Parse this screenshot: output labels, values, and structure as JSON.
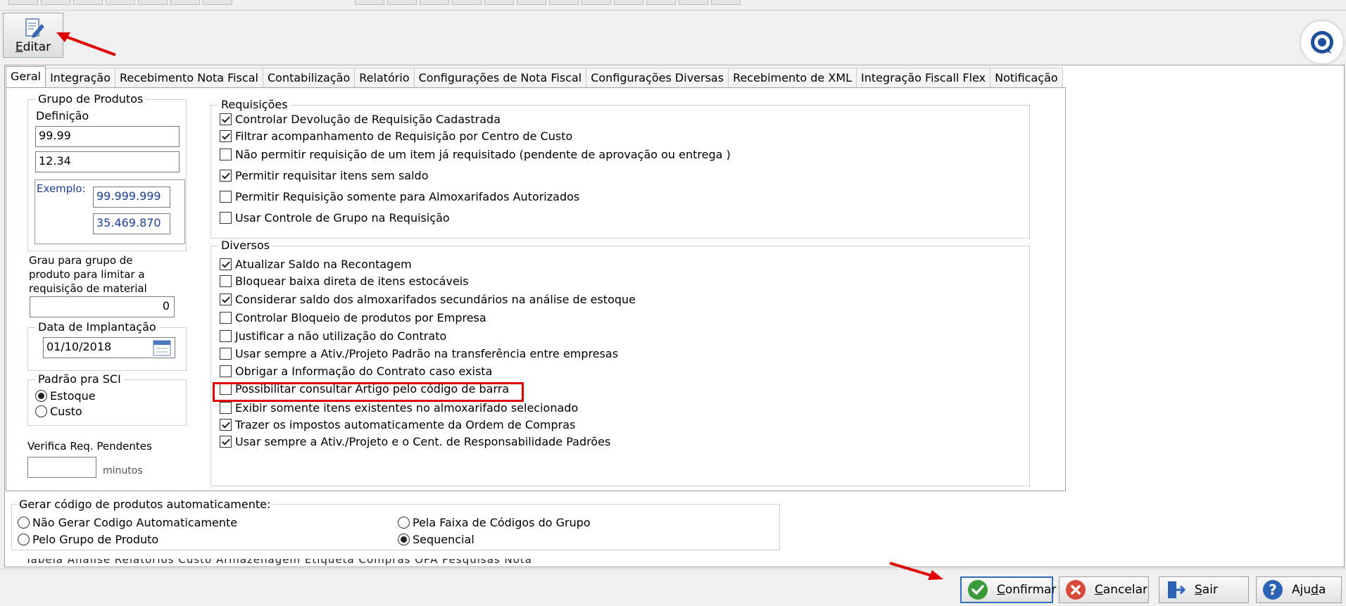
{
  "toolbar": {
    "edit_label_u": "E",
    "edit_label_rest": "ditar"
  },
  "tabs": [
    {
      "label": "Geral",
      "active": true
    },
    {
      "label": "Integração",
      "active": false
    },
    {
      "label": "Recebimento Nota Fiscal",
      "active": false
    },
    {
      "label": "Contabilização",
      "active": false
    },
    {
      "label": "Relatório",
      "active": false
    },
    {
      "label": "Configurações de Nota Fiscal",
      "active": false
    },
    {
      "label": "Configurações Diversas",
      "active": false
    },
    {
      "label": "Recebimento de XML",
      "active": false
    },
    {
      "label": "Integração Fiscall Flex",
      "active": false
    },
    {
      "label": "Notificação",
      "active": false
    }
  ],
  "grupo_produtos": {
    "legend": "Grupo de Produtos",
    "definicao_label": "Definição",
    "definicao_1": "99.99",
    "definicao_2": "12.34",
    "exemplo_label": "Exemplo:",
    "exemplo_1": "99.999.999",
    "exemplo_2": "35.469.870"
  },
  "grau": {
    "line1": "Grau para grupo de",
    "line2": "produto para limitar a",
    "line3": "requisição de material",
    "value": "0"
  },
  "data_implantacao": {
    "legend": "Data de Implantação",
    "value": "01/10/2018"
  },
  "padrao_sci": {
    "legend": "Padrão pra SCI",
    "options": [
      {
        "label": "Estoque",
        "selected": true
      },
      {
        "label": "Custo",
        "selected": false
      }
    ]
  },
  "verifica": {
    "label": "Verifica Req. Pendentes",
    "value": "",
    "unit": "minutos"
  },
  "requisicoes": {
    "legend": "Requisições",
    "items": [
      {
        "label": "Controlar Devolução de Requisição Cadastrada",
        "checked": true
      },
      {
        "label": "Filtrar acompanhamento de Requisição por Centro de Custo",
        "checked": true
      },
      {
        "label": "Não permitir requisição de um item já requisitado (pendente de aprovação ou entrega )",
        "checked": false
      },
      {
        "label": "Permitir requisitar itens sem saldo",
        "checked": true
      },
      {
        "label": "Permitir Requisição somente para Almoxarifados Autorizados",
        "checked": false
      },
      {
        "label": "Usar Controle de Grupo na Requisição",
        "checked": false
      }
    ]
  },
  "diversos": {
    "legend": "Diversos",
    "items": [
      {
        "label": "Atualizar Saldo na Recontagem",
        "checked": true
      },
      {
        "label": "Bloquear baixa direta de itens estocáveis",
        "checked": false
      },
      {
        "label": "Considerar saldo dos almoxarifados secundários na análise de estoque",
        "checked": true
      },
      {
        "label": "Controlar Bloqueio de produtos por Empresa",
        "checked": false
      },
      {
        "label": "Justificar a não utilização do Contrato",
        "checked": false
      },
      {
        "label": "Usar sempre a Ativ./Projeto Padrão na transferência entre empresas",
        "checked": false
      },
      {
        "label": "Obrigar a Informação do Contrato caso exista",
        "checked": false
      },
      {
        "label": "Possibilitar consultar Artigo pelo código de barra",
        "checked": false
      },
      {
        "label": "Exibir somente itens existentes no almoxarifado selecionado",
        "checked": false
      },
      {
        "label": "Trazer os impostos automaticamente da Ordem de Compras",
        "checked": true
      },
      {
        "label": "Usar sempre a Ativ./Projeto e o Cent. de Responsabilidade Padrões",
        "checked": true
      }
    ]
  },
  "gerar_codigo": {
    "legend": "Gerar código de produtos automaticamente:",
    "options": [
      {
        "label": "Não Gerar Codigo Automaticamente",
        "selected": false
      },
      {
        "label": "Pelo Grupo de Produto",
        "selected": false
      },
      {
        "label": "Pela Faixa de Códigos do Grupo",
        "selected": false
      },
      {
        "label": "Sequencial",
        "selected": true
      }
    ]
  },
  "cut_tabs_text": "Tabela Análise   Relatórios   Custo   Armazenagem   Etiqueta   Compras   OPA   Pesquisas   Nota",
  "buttons": {
    "confirmar_u": "C",
    "confirmar_rest": "onfirmar",
    "cancelar_u": "C",
    "cancelar_rest": "ancelar",
    "sair_u": "S",
    "sair_rest": "air",
    "ajuda_pre": "Aju",
    "ajuda_u": "d",
    "ajuda_rest": "a"
  },
  "colors": {
    "accent": "#2f6fb5",
    "highlight": "#e00000",
    "confirm_green": "#3a9b3a",
    "cancel_red": "#d84a3a",
    "help_blue": "#2b63b5"
  }
}
